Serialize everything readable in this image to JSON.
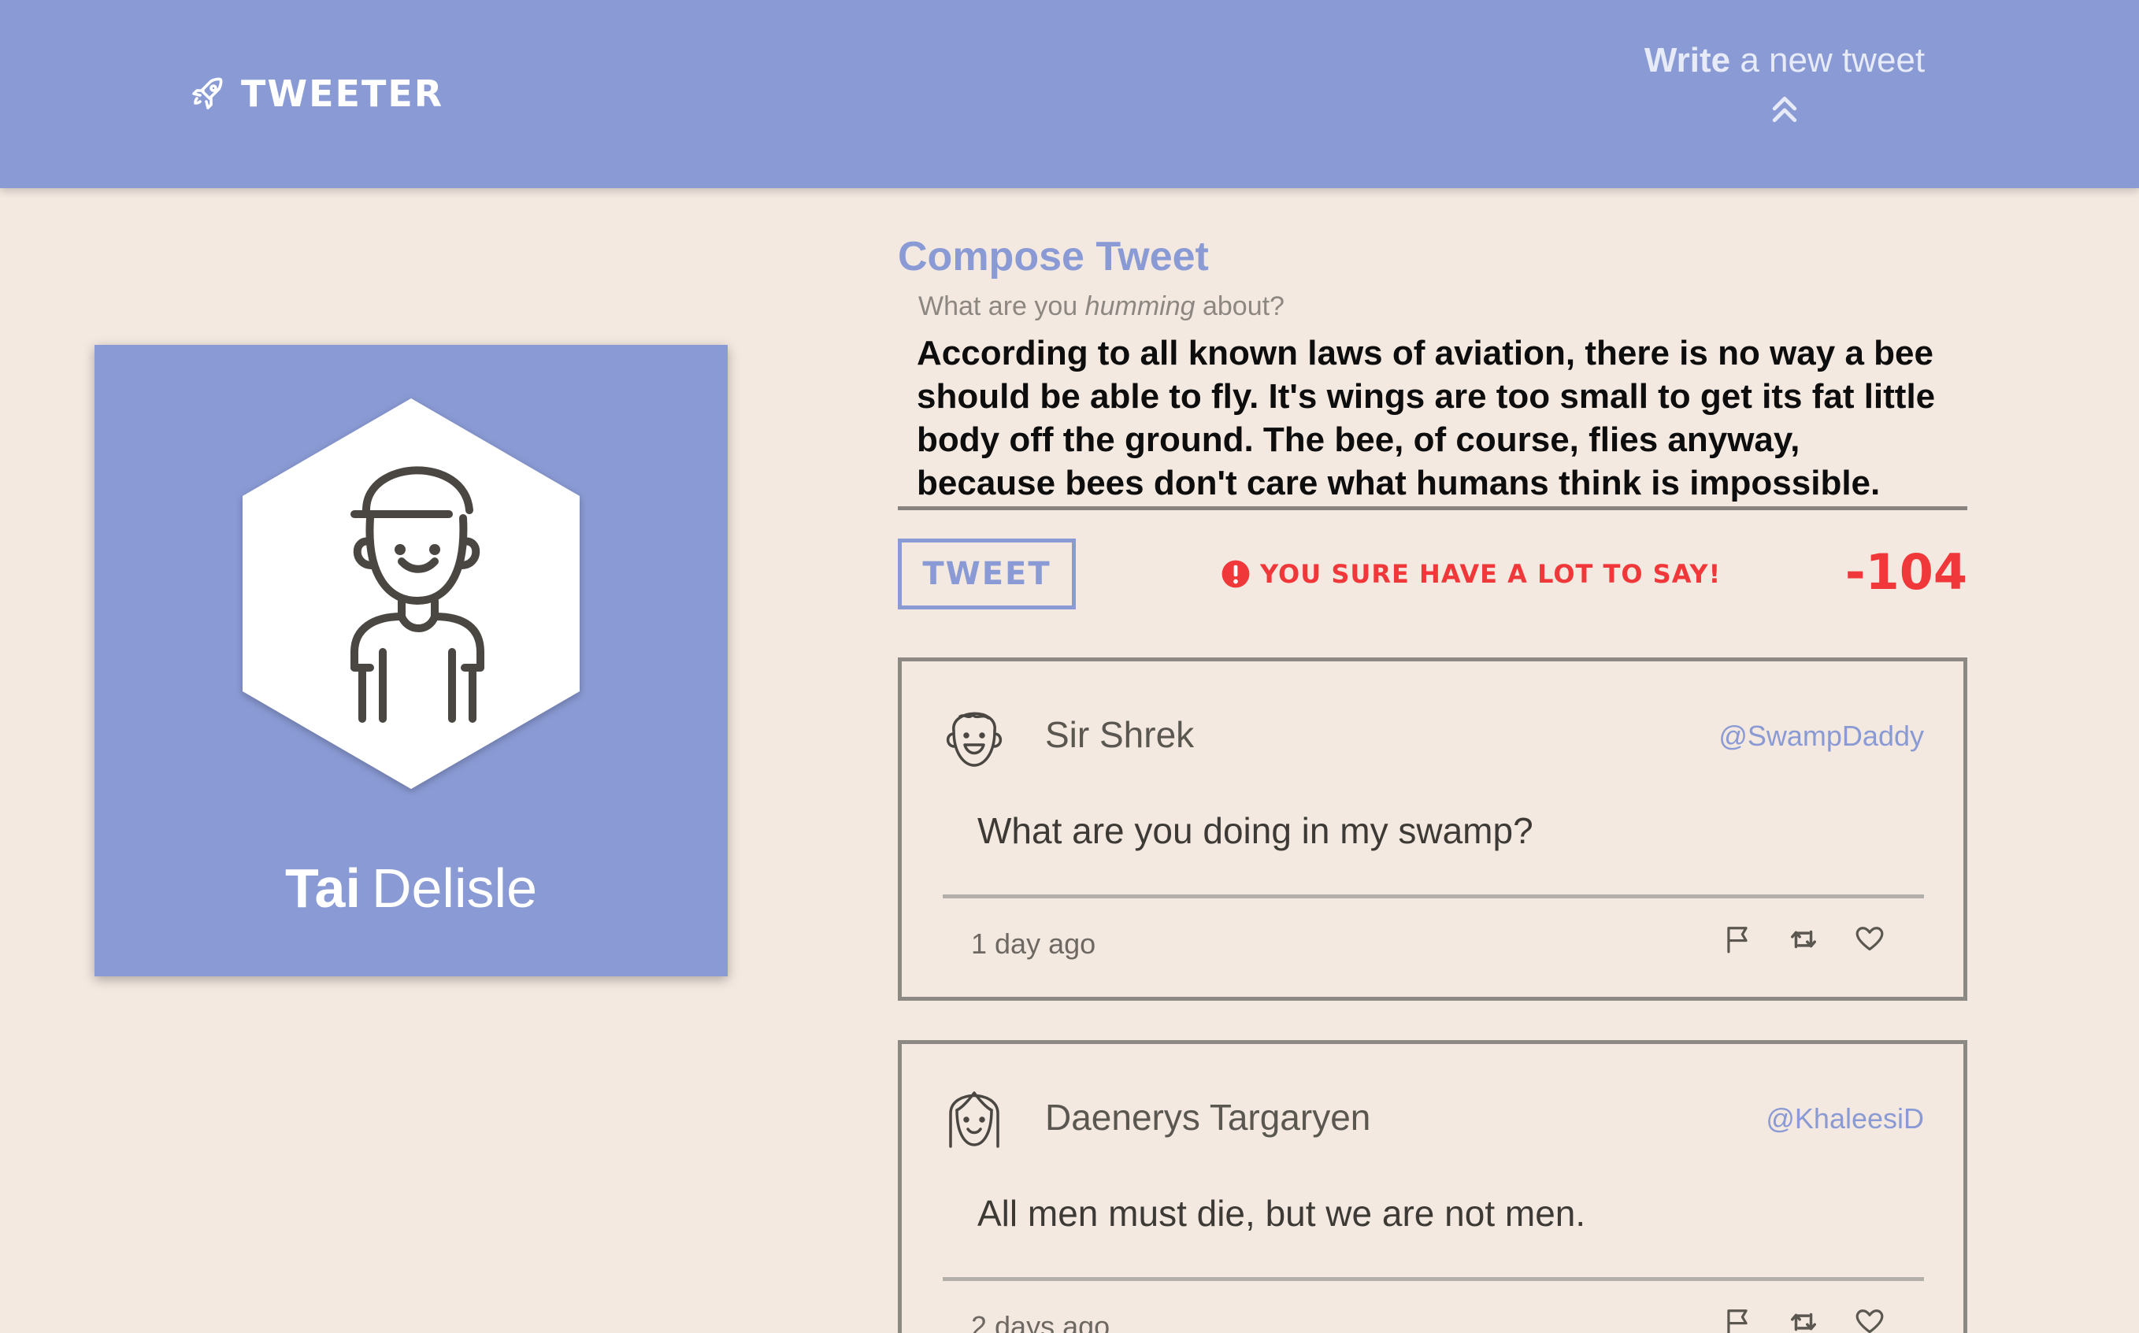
{
  "nav": {
    "brand": "TWEETER",
    "compose_toggle_bold": "Write",
    "compose_toggle_rest": "a new tweet"
  },
  "profile": {
    "first_name": "Tai",
    "last_name": "Delisle"
  },
  "compose": {
    "title": "Compose Tweet",
    "prompt_before": "What are you",
    "prompt_emph": "humming",
    "prompt_after": "about?",
    "text": "According to all known laws of aviation, there is no way a bee should be able to fly. It's wings are too small to get its fat little body off the ground. The bee, of course, flies anyway, because bees don't care what humans think is impossible.",
    "button_label": "TWEET",
    "error": "YOU SURE HAVE A LOT TO SAY!",
    "counter": "-104"
  },
  "tweets": [
    {
      "name": "Sir Shrek",
      "handle": "@SwampDaddy",
      "body": "What are you doing in my swamp?",
      "time": "1 day ago",
      "avatar_icon": "smiling-boy-face-icon"
    },
    {
      "name": "Daenerys Targaryen",
      "handle": "@KhaleesiD",
      "body": "All men must die, but we are not men.",
      "time": "2 days ago",
      "avatar_icon": "smiling-girl-face-icon"
    }
  ],
  "colors": {
    "accent": "#8a9ad4",
    "background": "#f4e9e1",
    "error": "#f0383a",
    "border": "#8c8884"
  }
}
